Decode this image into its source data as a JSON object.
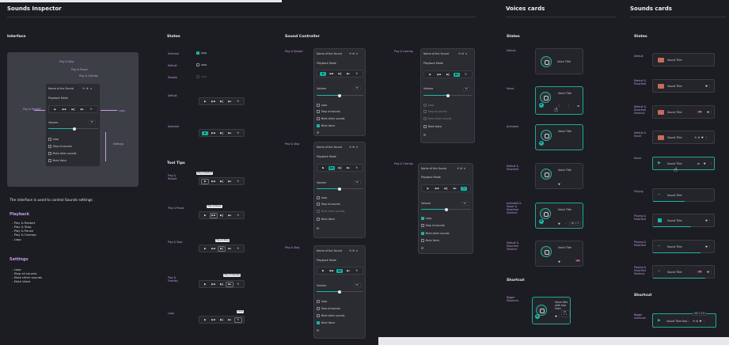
{
  "titles": {
    "sounds_inspector": "Sounds Inspector",
    "voices_cards": "Voices cards",
    "sounds_cards": "Sounds cards"
  },
  "sections": {
    "interface": "Interface",
    "states": "States",
    "sound_controller": "Sound Controller",
    "tool_tips": "Tool Tips",
    "states_voice": "States",
    "states_sound": "States",
    "shortcut_voice": "Shortcut",
    "shortcut_sound": "Shortcut"
  },
  "interface": {
    "sound_name": "Name of the Sound",
    "playback_mode": "Playback Mode",
    "volume": "Volume",
    "volume_value": "50",
    "checks": [
      "Loop",
      "Stop all sounds",
      "Mute other sounds",
      "Mute Voice"
    ],
    "callouts": {
      "play_stop": "Play & Stop",
      "play_pause": "Play & Pause",
      "play_overlap": "Play & Overlap",
      "play_restart": "Play & Restart",
      "loop": "Loop",
      "settings": "Settings"
    },
    "desc": "The interface is used to control Sounds settings",
    "playback_title": "Playback",
    "playback_items": [
      "- Play & Restart",
      "- Play & Stop",
      "- Play & Pause",
      "- Play & Overlap",
      "- Loop"
    ],
    "settings_title": "Settings",
    "settings_items": [
      "- Loop",
      "- Stop all sounds",
      "- Mute other sounds",
      "- Mute Voice"
    ]
  },
  "states": {
    "rows": [
      "Selected",
      "Default",
      "Disable"
    ],
    "check_label": "Loop",
    "ctrl_rows": [
      "Default",
      "Selected"
    ]
  },
  "tooltips": {
    "rows": [
      "Play & Restart",
      "Play & Pause",
      "Play & Stop",
      "Play & Overlap",
      "Loop"
    ],
    "tips": [
      "Play & Restart",
      "Play & Pause",
      "Play & Stop",
      "Play & Overlap",
      "Loop"
    ]
  },
  "controller": {
    "labels": [
      "Play & Restart",
      "Play & Overlap",
      "Play & Stop",
      "Play & Overlap",
      "Play & Stop"
    ],
    "sound_name": "Name of the Sound",
    "playback_mode": "Playback Mode",
    "volume": "Volume",
    "volume_value": "50",
    "checks": [
      "Loop",
      "Stop all sounds",
      "Mute other sounds",
      "Mute Voice"
    ]
  },
  "voice": {
    "states": [
      "Default",
      "Hover",
      "Activated",
      "Default & Favorited",
      "Activated & Hover & Favorited Shortcut",
      "Default & Favorited Shortcut"
    ],
    "title": "Voice Title",
    "shortcut_label": "Bigger Shortcuts",
    "shortcut_title": "Voice title with two lines",
    "key_badge": "Alt + 1"
  },
  "sound": {
    "states": [
      "Default",
      "Default & Favorited",
      "Default & Favorited Shortcut",
      "Default & Hover",
      "Hover",
      "Playing",
      "Playing & Favorited",
      "Playing & Favorited",
      "Playing & Favorited Shortcut"
    ],
    "title": "Sound Title",
    "badge": "Alt",
    "shortcut_label": "Bigger shortcuts",
    "shortcut_title": "Sound Title Gen...",
    "key_badge": "Alt + 1.0"
  },
  "colors": {
    "accent": "#1fb7a7",
    "label": "#c79be8",
    "bg": "#1c1d22",
    "panel": "#2a2c32"
  }
}
